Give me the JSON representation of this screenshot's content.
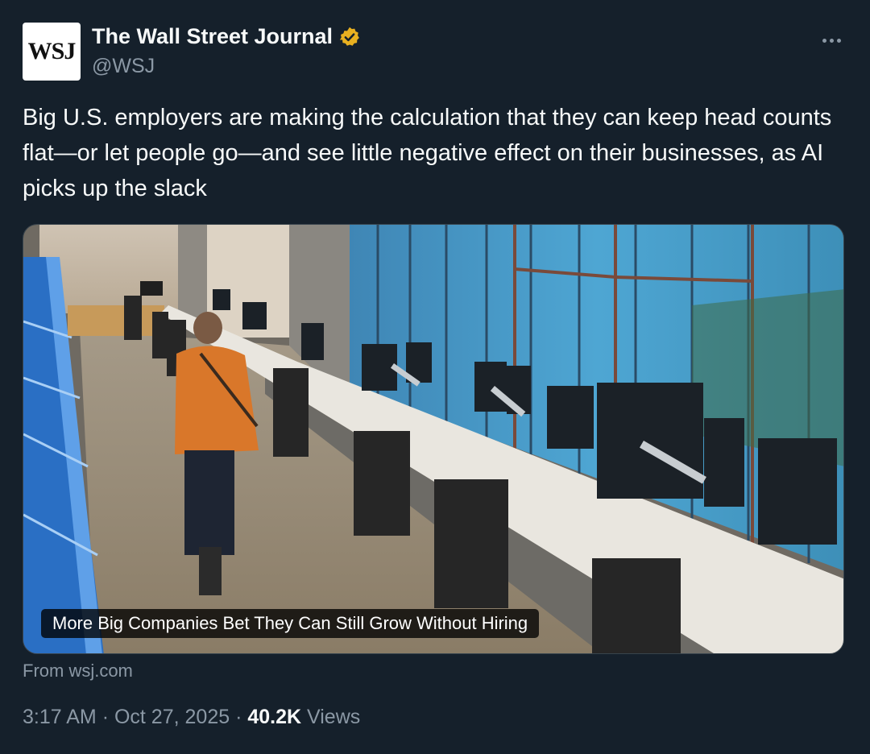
{
  "author": {
    "logo_text": "WSJ",
    "display_name": "The Wall Street Journal",
    "handle": "@WSJ",
    "verified_badge_icon": "verified-gold-badge-icon",
    "badge_color": "#e8b020"
  },
  "more_icon": "more-horizontal-icon",
  "tweet": {
    "text": "Big U.S. employers are making the calculation that they can keep head counts flat—or let people go—and see little negative effect on their businesses, as AI picks up the slack"
  },
  "card": {
    "title": "More Big Companies Bet They Can Still Grow Without Hiring",
    "source": "From wsj.com"
  },
  "meta": {
    "time": "3:17 AM",
    "separator": "·",
    "date": "Oct 27, 2025",
    "views_count": "40.2K",
    "views_label": "Views"
  },
  "colors": {
    "background": "#15202b",
    "primary_text": "#f7f9f9",
    "secondary_text": "#8b98a5"
  }
}
